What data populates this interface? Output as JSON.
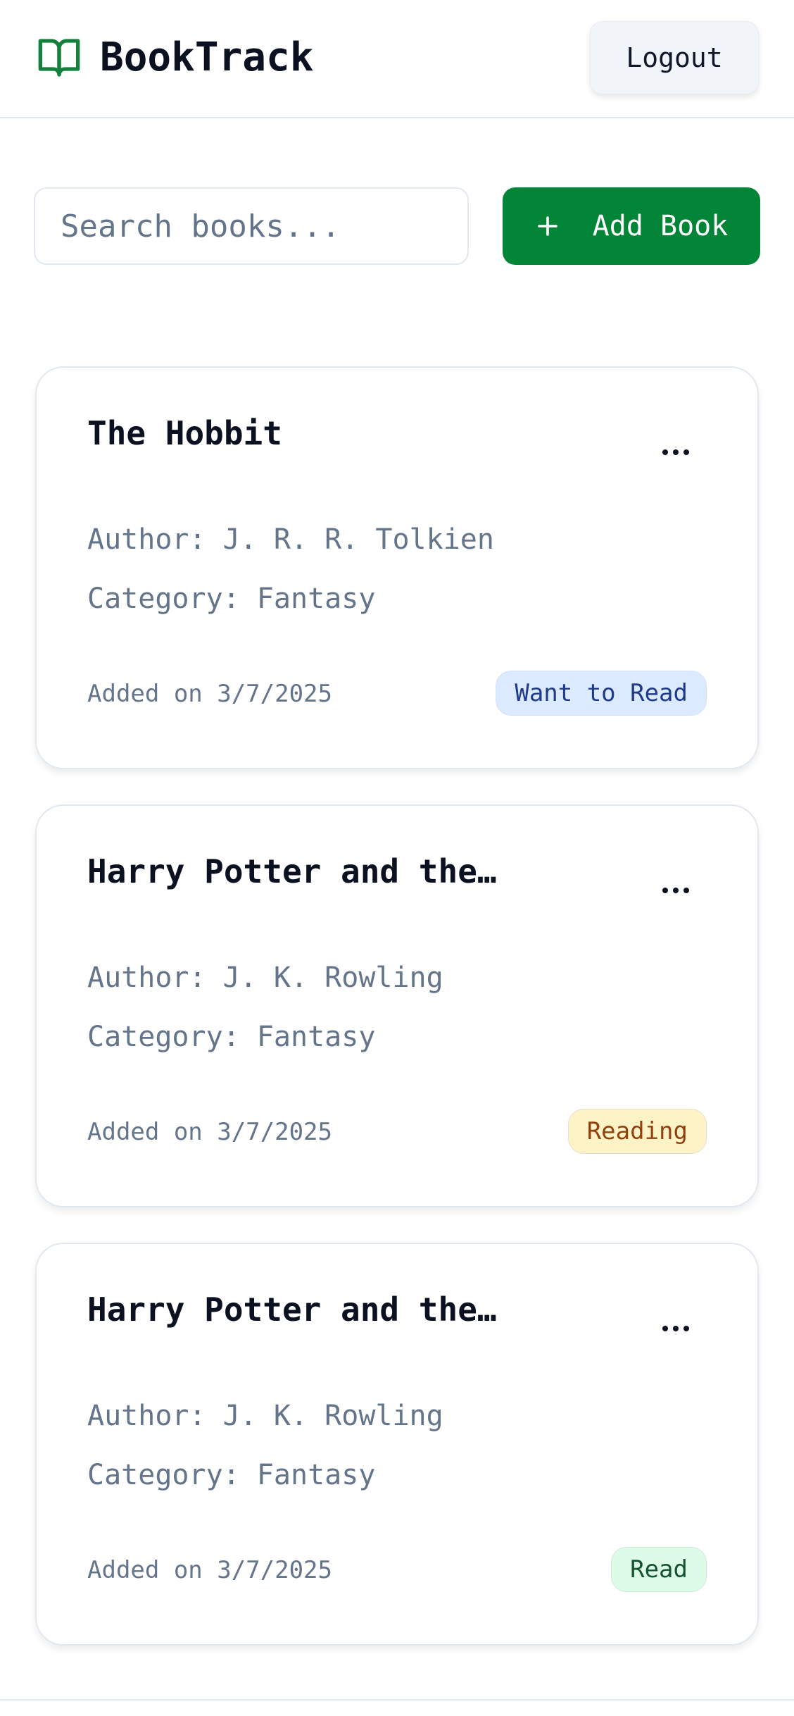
{
  "header": {
    "brand": "BookTrack",
    "logout_label": "Logout"
  },
  "toolbar": {
    "search_placeholder": "Search books...",
    "add_label": "Add Book"
  },
  "books": [
    {
      "title": "The Hobbit",
      "author": "Author: J. R. R. Tolkien",
      "category": "Category: Fantasy",
      "added": "Added on 3/7/2025",
      "status": "Want to Read"
    },
    {
      "title": "Harry Potter and the…",
      "author": "Author: J. K. Rowling",
      "category": "Category: Fantasy",
      "added": "Added on 3/7/2025",
      "status": "Reading"
    },
    {
      "title": "Harry Potter and the…",
      "author": "Author: J. K. Rowling",
      "category": "Category: Fantasy",
      "added": "Added on 3/7/2025",
      "status": "Read"
    }
  ],
  "icons": {
    "brand": "book-open-icon",
    "add": "plus-icon",
    "card_menu": "more-horizontal-icon"
  },
  "colors": {
    "brand_green": "#028536",
    "want_to_read_bg": "#dbeafe",
    "want_to_read_text": "#1e3a8a",
    "reading_bg": "#fef3c7",
    "reading_text": "#92400e",
    "read_bg": "#dcfce7",
    "read_text": "#14532d"
  }
}
